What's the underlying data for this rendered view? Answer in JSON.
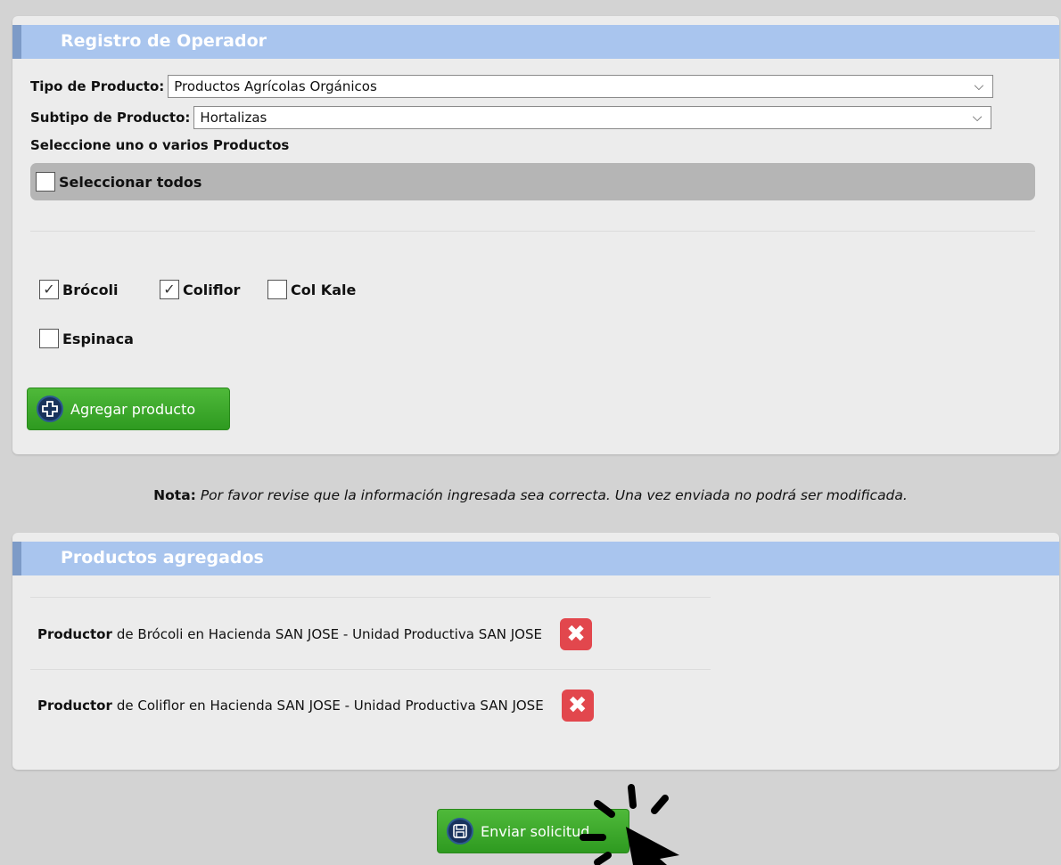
{
  "registro": {
    "title": "Registro de Operador",
    "tipo_label": "Tipo de Producto:",
    "tipo_value": "Productos Agrícolas Orgánicos",
    "subtipo_label": "Subtipo de Producto:",
    "subtipo_value": "Hortalizas",
    "seleccione_label": "Seleccione uno o varios Productos",
    "select_all_label": "Seleccionar todos",
    "products": [
      {
        "label": "Brócoli",
        "checked": true
      },
      {
        "label": "Coliflor",
        "checked": true
      },
      {
        "label": "Col Kale",
        "checked": false
      },
      {
        "label": "Espinaca",
        "checked": false
      }
    ],
    "add_button_label": "Agregar producto"
  },
  "nota": {
    "bold": "Nota:",
    "text": "Por favor revise que la información ingresada sea correcta. Una vez enviada no podrá ser modificada."
  },
  "productos_agregados": {
    "title": "Productos agregados",
    "items": [
      {
        "role": "Productor",
        "text": "de Brócoli en Hacienda SAN JOSE - Unidad Productiva SAN JOSE"
      },
      {
        "role": "Productor",
        "text": "de Coliflor en Hacienda SAN JOSE - Unidad Productiva SAN JOSE"
      }
    ]
  },
  "submit_button_label": "Enviar solicitud",
  "icons": {
    "dropdown": "chevron-down-icon",
    "check": "checkmark-icon",
    "add": "plus-circle-icon",
    "delete": "close-x-icon",
    "save": "floppy-disk-icon",
    "cursor": "pointer-cursor-icon"
  },
  "colors": {
    "header": "#a9c5ee",
    "green_button": "#3aa82a",
    "delete": "#e2474d",
    "panel": "#ececec",
    "page": "#d3d3d3"
  }
}
